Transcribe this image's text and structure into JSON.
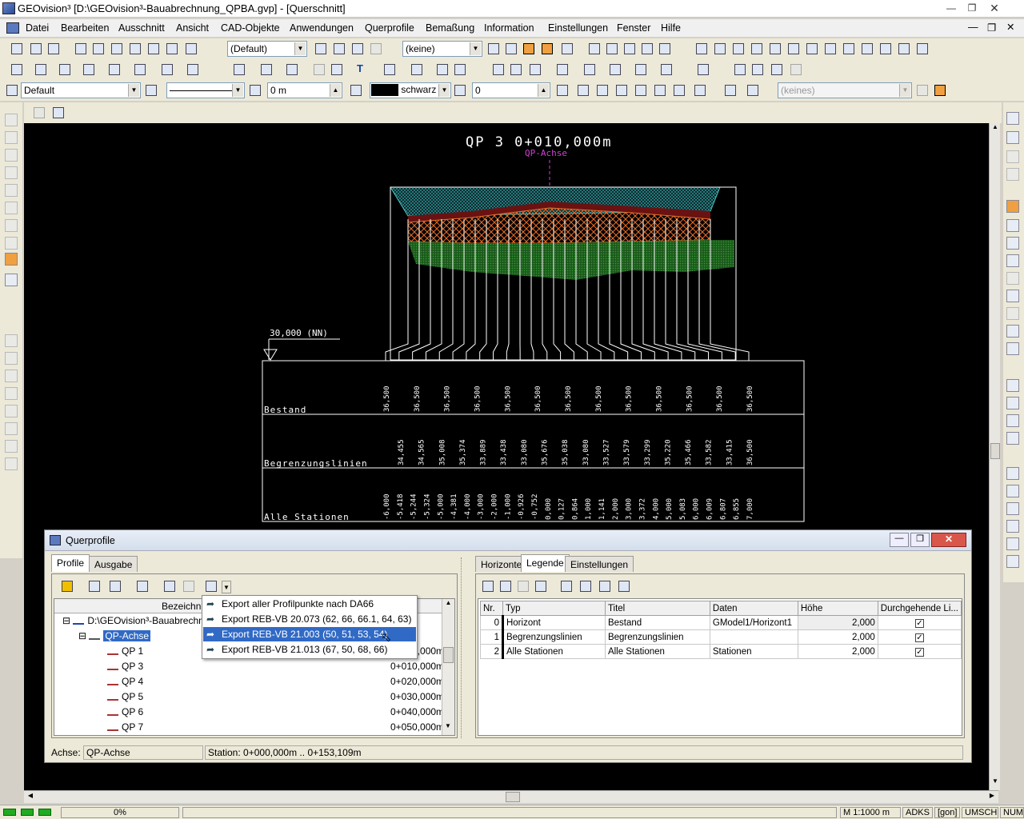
{
  "window": {
    "title": "GEOvision³  [D:\\GEOvision³-Bauabrechnung_QPBA.gvp] - [Querschnitt]"
  },
  "menu": [
    "Datei",
    "Bearbeiten",
    "Ausschnitt",
    "Ansicht",
    "CAD-Objekte",
    "Anwendungen",
    "Querprofile",
    "Bemaßung",
    "Information",
    "Einstellungen",
    "Fenster",
    "Hilfe"
  ],
  "toolbar1": {
    "style_value": "(Default)",
    "layer_value": "(keine)"
  },
  "toolbar3": {
    "linestyle_value": "Default",
    "height_value": "0 m",
    "color_label": "schwarz",
    "number_value": "0",
    "none_value": "(keines)"
  },
  "drawing": {
    "title": "QP 3   0+010,000m",
    "axis_label": "QP-Achse",
    "height_marker": "30,000 (NN)",
    "band_labels": [
      "Bestand",
      "Begrenzungslinien",
      "Alle Stationen"
    ],
    "bestand_values": [
      "36,500",
      "36,500",
      "36,500",
      "36,500",
      "36,500",
      "36,500",
      "36,500",
      "36,500",
      "36,500",
      "36,500",
      "36,500",
      "36,500",
      "36,500"
    ],
    "begrenzung_values": [
      "34,455",
      "34,565",
      "35,008",
      "35,374",
      "33,889",
      "33,438",
      "33,080",
      "35,676",
      "35,038",
      "33,080",
      "33,527",
      "33,579",
      "33,299",
      "35,220",
      "35,466",
      "33,582",
      "33,415",
      "36,500"
    ],
    "stationen_values": [
      "-6,000",
      "-5,418",
      "-5,244",
      "-5,324",
      "-5,000",
      "-4,381",
      "-4,000",
      "-3,000",
      "-2,000",
      "-1,000",
      "-0,926",
      "-0,752",
      "0,000",
      "0,127",
      "0,864",
      "1,000",
      "1,141",
      "2,000",
      "3,000",
      "3,372",
      "4,000",
      "5,000",
      "5,083",
      "6,000",
      "6,009",
      "6,807",
      "6,855",
      "7,000"
    ]
  },
  "dialog": {
    "title": "Querprofile",
    "left_tabs": [
      "Profile",
      "Ausgabe"
    ],
    "right_tabs": [
      "Horizonte",
      "Legende",
      "Einstellungen"
    ],
    "tree_header": "Bezeichnu",
    "tree": {
      "root": "D:\\GEOvision³-Bauabrechnu",
      "axis": "QP-Achse",
      "items": [
        {
          "name": "QP 1",
          "station": "0+000,000m"
        },
        {
          "name": "QP 3",
          "station": "0+010,000m"
        },
        {
          "name": "QP 4",
          "station": "0+020,000m"
        },
        {
          "name": "QP 5",
          "station": "0+030,000m"
        },
        {
          "name": "QP 6",
          "station": "0+040,000m"
        },
        {
          "name": "QP 7",
          "station": "0+050,000m"
        }
      ]
    },
    "context_menu": [
      "Export aller Profilpunkte nach DA66",
      "Export REB-VB 20.073 (62, 66, 66.1, 64, 63)",
      "Export REB-VB 21.003 (50, 51, 53, 54)",
      "Export REB-VB 21.013 (67, 50, 68, 66)"
    ],
    "legend_headers": [
      "Nr.",
      "Typ",
      "Titel",
      "Daten",
      "Höhe",
      "Durchgehende Li..."
    ],
    "legend_rows": [
      {
        "nr": "0",
        "typ": "Horizont",
        "titel": "Bestand",
        "daten": "GModel1/Horizont1",
        "hoehe": "2,000",
        "checked": true
      },
      {
        "nr": "1",
        "typ": "Begrenzungslinien",
        "titel": "Begrenzungslinien",
        "daten": "",
        "hoehe": "2,000",
        "checked": true
      },
      {
        "nr": "2",
        "typ": "Alle Stationen",
        "titel": "Alle Stationen",
        "daten": "Stationen",
        "hoehe": "2,000",
        "checked": true
      }
    ],
    "status": {
      "axis_label": "Achse:",
      "axis_value": "QP-Achse",
      "station_label": "Station:",
      "station_value": "0+000,000m .. 0+153,109m"
    }
  },
  "statusbar": {
    "progress": "0%",
    "scale": "M 1:1000  m",
    "mode1": "ADKS",
    "mode2": "[gon]",
    "mode3": "UMSCH",
    "mode4": "NUM"
  }
}
